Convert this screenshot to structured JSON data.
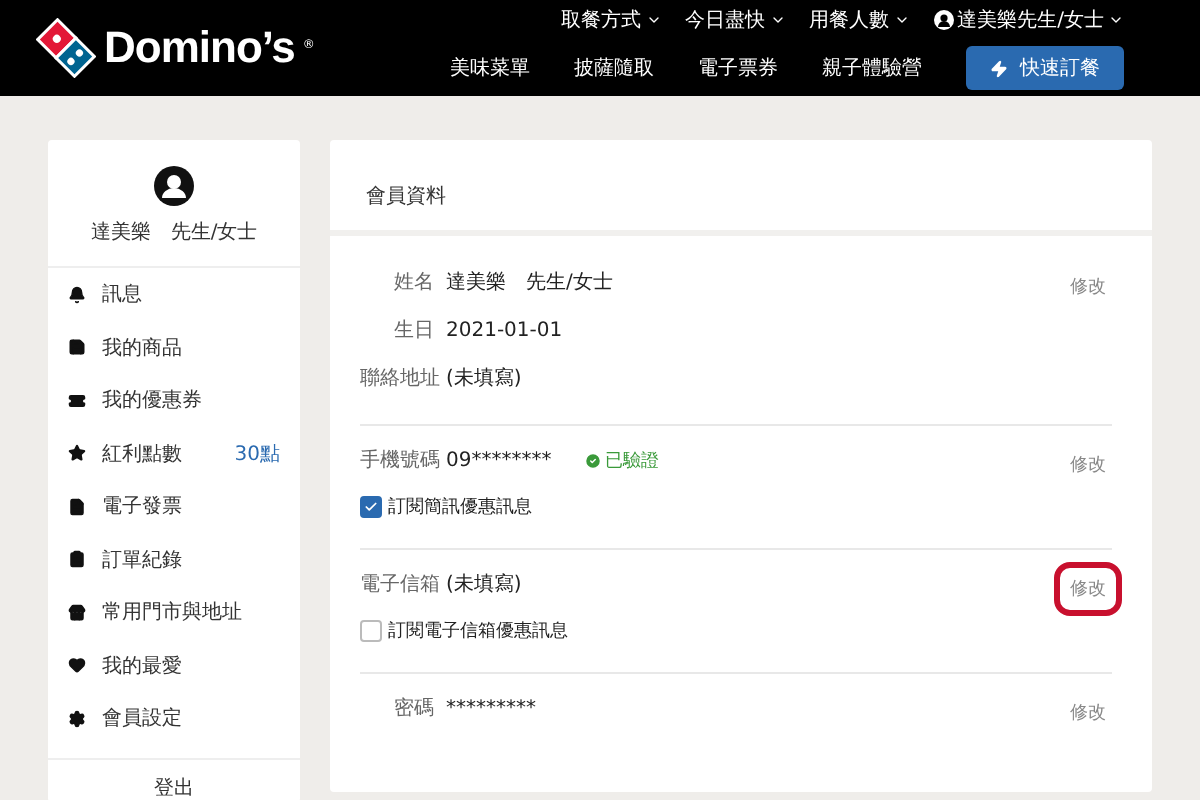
{
  "header": {
    "brand": "Domino’s",
    "brand_mark": "®",
    "top_menu": [
      "取餐方式",
      "今日盡快",
      "用餐人數"
    ],
    "user": "達美樂先生/女士",
    "nav": [
      "美味菜單",
      "披薩隨取",
      "電子票券",
      "親子體驗營"
    ],
    "order_button": "快速訂餐"
  },
  "sidebar": {
    "user_name": "達美樂　先生/女士",
    "items": [
      {
        "label": "訊息"
      },
      {
        "label": "我的商品"
      },
      {
        "label": "我的優惠券"
      },
      {
        "label": "紅利點數",
        "count": "30點"
      },
      {
        "label": "電子發票"
      },
      {
        "label": "訂單紀錄"
      },
      {
        "label": "常用門市與地址"
      },
      {
        "label": "我的最愛"
      },
      {
        "label": "會員設定"
      }
    ],
    "logout": "登出"
  },
  "profile": {
    "title": "會員資料",
    "sections": [
      {
        "edit": "修改",
        "highlighted": false,
        "fields": [
          {
            "label": "姓名",
            "value": "達美樂　先生/女士"
          },
          {
            "label": "生日",
            "value": "2021-01-01"
          },
          {
            "label": "聯絡地址",
            "value": "(未填寫)"
          }
        ]
      },
      {
        "edit": "修改",
        "highlighted": false,
        "fields": [
          {
            "label": "手機號碼",
            "value": "09********",
            "badge": "已驗證"
          }
        ],
        "checkbox": {
          "label": "訂閱簡訊優惠訊息",
          "checked": true
        }
      },
      {
        "edit": "修改",
        "highlighted": true,
        "fields": [
          {
            "label": "電子信箱",
            "value": "(未填寫)"
          }
        ],
        "checkbox": {
          "label": "訂閱電子信箱優惠訊息",
          "checked": false
        }
      },
      {
        "edit": "修改",
        "highlighted": false,
        "fields": [
          {
            "label": "密碼",
            "value": "*********"
          }
        ]
      }
    ]
  }
}
